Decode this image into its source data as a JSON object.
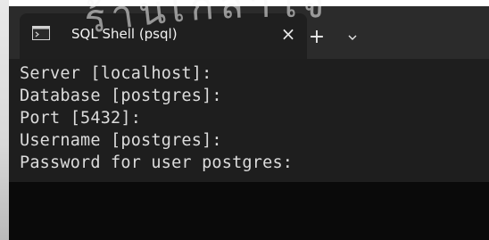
{
  "window": {
    "tab_title": "SQL Shell (psql)",
    "tab_icon": "terminal-icon",
    "close_glyph": "×",
    "new_tab_glyph": "+",
    "dropdown_glyph": "⌄"
  },
  "terminal": {
    "lines": [
      "Server [localhost]:",
      "Database [postgres]:",
      "Port [5432]:",
      "Username [postgres]:",
      "Password for user postgres:"
    ]
  },
  "watermark": {
    "text": "ร้านเกล้าใจ"
  }
}
